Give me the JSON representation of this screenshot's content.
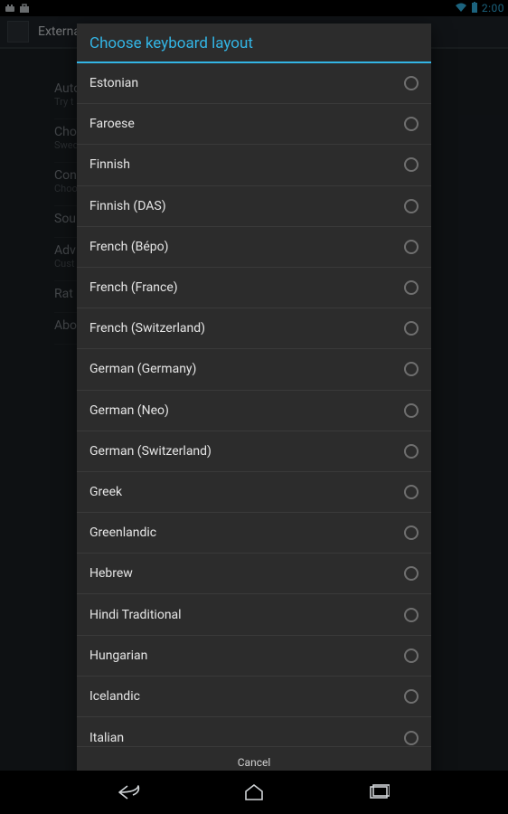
{
  "statusbar": {
    "time": "2:00"
  },
  "actionbar": {
    "title": "External Keyboard"
  },
  "background_settings": {
    "items": [
      {
        "title": "Auto",
        "subtitle": "Try t"
      },
      {
        "title": "Cho",
        "subtitle": "Swed"
      },
      {
        "title": "Con",
        "subtitle": "Choo"
      },
      {
        "title": "Sou",
        "subtitle": ""
      },
      {
        "title": "Adv",
        "subtitle": "Cust"
      },
      {
        "title": "Rat",
        "subtitle": ""
      },
      {
        "title": "Abo",
        "subtitle": ""
      }
    ]
  },
  "dialog": {
    "title": "Choose keyboard layout",
    "cancel": "Cancel",
    "items": [
      "Estonian",
      "Faroese",
      "Finnish",
      "Finnish (DAS)",
      "French (Bépo)",
      "French (France)",
      "French (Switzerland)",
      "German (Germany)",
      "German (Neo)",
      "German (Switzerland)",
      "Greek",
      "Greenlandic",
      "Hebrew",
      "Hindi Traditional",
      "Hungarian",
      "Icelandic",
      "Italian"
    ]
  }
}
